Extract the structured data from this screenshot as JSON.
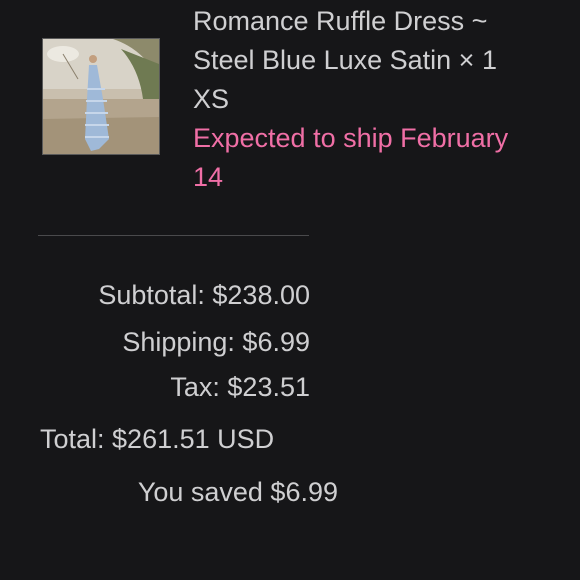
{
  "product": {
    "title_line1": "Romance Ruffle Dress ~",
    "title_line2": "Steel Blue Luxe Satin × 1",
    "size": "XS",
    "ship_line1": "Expected to ship February",
    "ship_line2": "14",
    "image_icon": "product-photo-dress"
  },
  "summary": {
    "subtotal": "Subtotal: $238.00",
    "shipping": "Shipping: $6.99",
    "tax": "Tax: $23.51",
    "total": "Total: $261.51 USD",
    "saved": "You saved $6.99"
  },
  "colors": {
    "background": "#161618",
    "text": "#cfcfd1",
    "accent": "#f06fa6"
  }
}
